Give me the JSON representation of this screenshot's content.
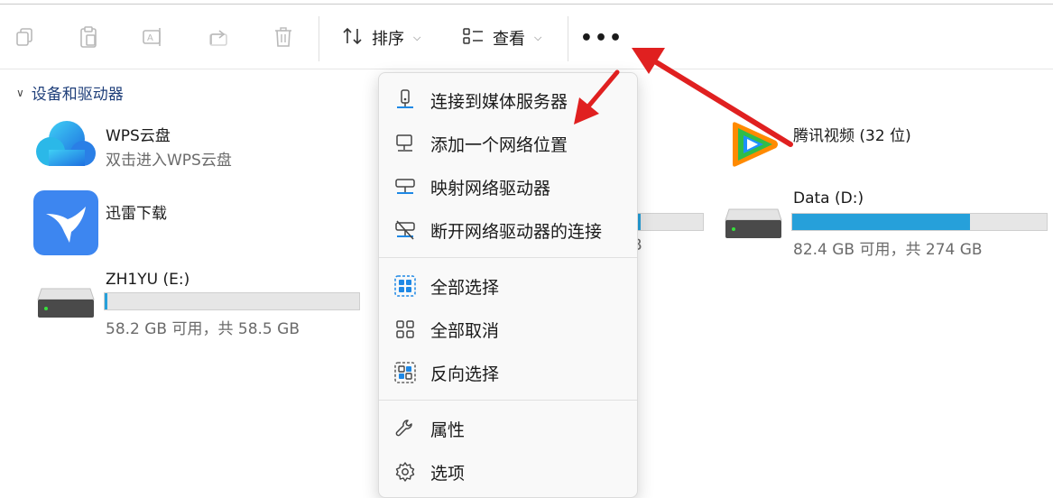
{
  "toolbar": {
    "sort_label": "排序",
    "view_label": "查看",
    "more_label": "•••"
  },
  "section": {
    "title": "设备和驱动器"
  },
  "drives": {
    "wps": {
      "name": "WPS云盘",
      "sub": "双击进入WPS云盘"
    },
    "xunlei": {
      "name": "迅雷下载"
    },
    "zh1yu": {
      "name": "ZH1YU (E:)",
      "info": "58.2 GB 可用，共 58.5 GB",
      "used_fraction": 0.005
    },
    "tencent": {
      "name": "腾讯视频 (32 位)"
    },
    "data": {
      "name": "Data (D:)",
      "info": "82.4 GB 可用，共 274 GB",
      "used_fraction": 0.7
    },
    "hidden_partial": {
      "info_tail": "B",
      "used_fraction": 1.0
    }
  },
  "menu": {
    "items": [
      {
        "label": "连接到媒体服务器",
        "icon": "media-server-icon"
      },
      {
        "label": "添加一个网络位置",
        "icon": "network-location-icon"
      },
      {
        "label": "映射网络驱动器",
        "icon": "map-drive-icon"
      },
      {
        "label": "断开网络驱动器的连接",
        "icon": "disconnect-drive-icon"
      },
      {
        "label": "全部选择",
        "icon": "select-all-icon"
      },
      {
        "label": "全部取消",
        "icon": "select-none-icon"
      },
      {
        "label": "反向选择",
        "icon": "invert-selection-icon"
      },
      {
        "label": "属性",
        "icon": "wrench-icon"
      },
      {
        "label": "选项",
        "icon": "gear-icon"
      }
    ]
  },
  "colors": {
    "accent": "#26a0da",
    "arrow": "#e02020",
    "section": "#1f3f7a"
  }
}
